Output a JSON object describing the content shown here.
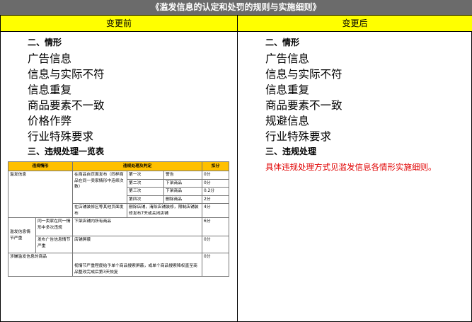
{
  "title": "《滥发信息的认定和处罚的规则与实施细则》",
  "left": {
    "header": "变更前",
    "section1_title": "二、情形",
    "items": [
      "广告信息",
      "信息与实际不符",
      "信息重复",
      "商品要素不一致",
      "价格作弊",
      "行业特殊要求"
    ],
    "section2_title": "三、违规处理一览表",
    "table": {
      "headers": [
        "违规情形",
        "违规处理及判定",
        "扣分"
      ],
      "row_flood": "滥发信息",
      "row_flood_rule1": "在商品自页面发布（同样商品在同一卖家情形中连续次数）",
      "steps": [
        {
          "n": "第一次",
          "p": "警告",
          "s": "0分"
        },
        {
          "n": "第二次",
          "p": "下架商品",
          "s": "0分"
        },
        {
          "n": "第三次",
          "p": "下架商品",
          "s": "0.2分"
        },
        {
          "n": "第四次",
          "p": "删除商品",
          "s": "2分"
        }
      ],
      "row_flood_rule2": "在店铺装修区等其他页面发布",
      "row_flood_rule2_action": "删除店铺，清除店铺装修，限制店铺装修发布7天或关闭店铺",
      "row_flood_rule2_score": "4分",
      "row_serious": "滥发信息情节严重",
      "row_serious_a": "同一卖家在同一情形中多次违规",
      "row_serious_a_action": "下架店铺内所有商品",
      "row_serious_a_score": "6分",
      "row_serious_b": "发布广告信息情节严重",
      "row_serious_b_action": "店铺屏蔽",
      "row_serious_b_score": "0分",
      "row_goods": "涉嫌滥发信息的商品",
      "row_goods_action": "视情节严重程度给予单个商品搜索屏蔽，或单个商品搜索降权直至商品整改完成后第3天恢复",
      "row_goods_score": "0分"
    }
  },
  "right": {
    "header": "变更后",
    "section1_title": "二、情形",
    "items": [
      "广告信息",
      "信息与实际不符",
      "信息重复",
      "商品要素不一致",
      "规避信息",
      "行业特殊要求"
    ],
    "section2_title": "三、违规处理",
    "note": "具体违规处理方式见滥发信息各情形实施细则。"
  },
  "colors": {
    "title_bg": "#6b6b6b",
    "header_bg": "#ffff00",
    "table_header_bg": "#ffc000",
    "note": "#e00000"
  }
}
